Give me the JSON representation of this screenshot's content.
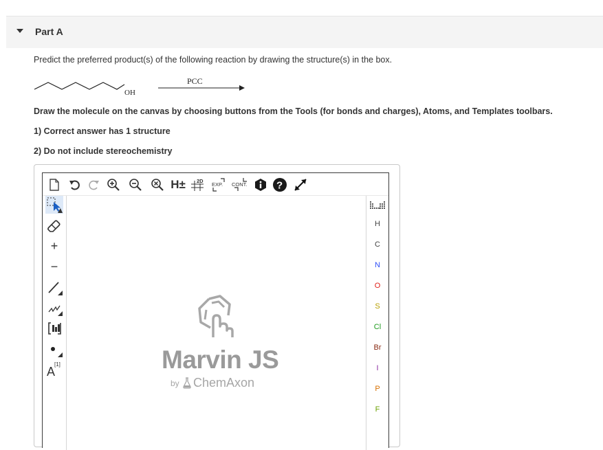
{
  "part": {
    "title": "Part A"
  },
  "question": {
    "prompt": "Predict the preferred product(s) of the following reaction by drawing the structure(s) in the box.",
    "reagent": "PCC",
    "substituent": "OH"
  },
  "instructions": {
    "main": "Draw the molecule on the canvas by choosing buttons from the Tools (for bonds and charges), Atoms, and Templates toolbars.",
    "item1": "1) Correct answer has 1 structure",
    "item2": "2) Do not include stereochemistry"
  },
  "editor": {
    "top_toolbar": {
      "h_toggle": "H±",
      "label_2d": "2D",
      "label_exp": "EXP.",
      "label_cont": "CONT."
    },
    "left_toolbar": {
      "plus": "+",
      "minus": "−",
      "atom_map": "A",
      "atom_map_sup": "[1]"
    },
    "atoms": [
      "H",
      "C",
      "N",
      "O",
      "S",
      "Cl",
      "Br",
      "I",
      "P",
      "F"
    ],
    "atom_colors": [
      "#444444",
      "#444444",
      "#3050f8",
      "#e0201a",
      "#b8a000",
      "#1c9a1c",
      "#8a2a12",
      "#8a2aa0",
      "#d87000",
      "#6aa000"
    ],
    "logo": {
      "name": "Marvin JS",
      "by": "by",
      "company": "ChemAxon"
    }
  }
}
